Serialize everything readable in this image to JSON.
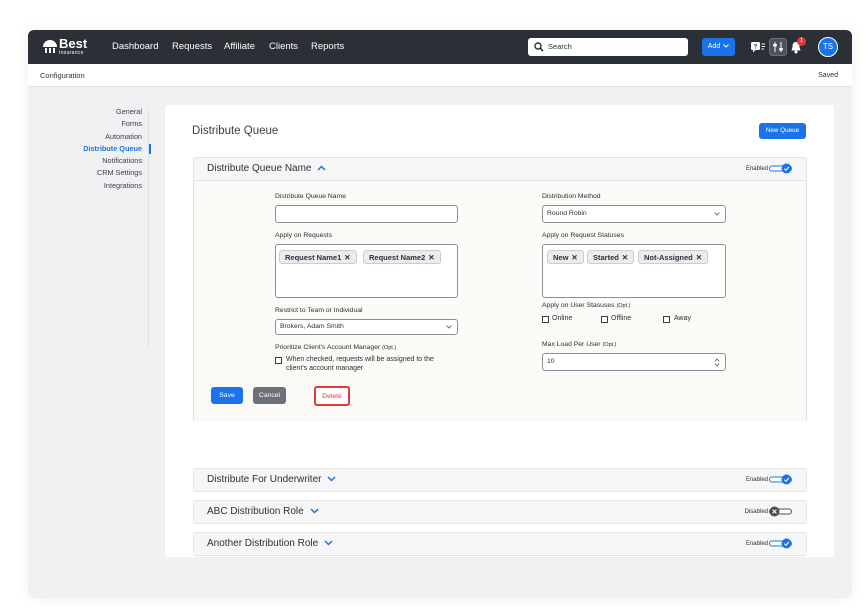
{
  "brand": {
    "name": "Best",
    "tagline": "Insurance"
  },
  "nav": {
    "items": [
      "Dashboard",
      "Requests",
      "Affiliate",
      "Clients",
      "Reports"
    ]
  },
  "search": {
    "placeholder": "Search"
  },
  "toolbar": {
    "add_label": "Add",
    "notification_count": "1",
    "avatar_initials": "TS"
  },
  "breadcrumb": {
    "label": "Configuration",
    "status": "Saved"
  },
  "sidebar": {
    "items": [
      {
        "label": "General",
        "active": false
      },
      {
        "label": "Forms",
        "active": false
      },
      {
        "label": "Automation",
        "active": false
      },
      {
        "label": "Distribute Queue",
        "active": true
      },
      {
        "label": "Notifications",
        "active": false
      },
      {
        "label": "CRM Settings",
        "active": false
      },
      {
        "label": "Integrations",
        "active": false
      }
    ]
  },
  "page": {
    "title": "Distribute Queue",
    "new_button": "New Queue"
  },
  "queues": [
    {
      "title": "Distribute Queue Name",
      "expanded": true,
      "state_label": "Enabled",
      "enabled": true
    },
    {
      "title": "Distribute For Underwriter",
      "expanded": false,
      "state_label": "Enabled",
      "enabled": true
    },
    {
      "title": "ABC Distribution Role",
      "expanded": false,
      "state_label": "Disabled",
      "enabled": false
    },
    {
      "title": "Another Distribution Role",
      "expanded": false,
      "state_label": "Enabled",
      "enabled": true
    }
  ],
  "form": {
    "name_label": "Distribute Queue Name",
    "name_value": "",
    "method_label": "Distribution Method",
    "method_value": "Round Robin",
    "requests_label": "Apply on Requests",
    "requests": [
      "Request Name1",
      "Request Name2"
    ],
    "statuses_label": "Apply on Request Statuses",
    "statuses": [
      "New",
      "Started",
      "Not-Assigned"
    ],
    "restrict_label": "Restrict to Team or Individual",
    "restrict_value": "Brokers, Adam Smith",
    "user_status_label": "Apply on User Stasuses",
    "user_status_opt": "(Opt.)",
    "user_statuses": [
      {
        "label": "Online",
        "checked": false
      },
      {
        "label": "Offline",
        "checked": false
      },
      {
        "label": "Away",
        "checked": false
      }
    ],
    "prioritize_label": "Prioritize Client's Account Manager",
    "prioritize_opt": "(Opt.)",
    "prioritize_line1": "When checked, requests will be assigned to the",
    "prioritize_line2": "client's account manager",
    "maxload_label": "Max Load Per User",
    "maxload_opt": "(Opt.)",
    "maxload_value": "10",
    "save_label": "Save",
    "cancel_label": "Cancel",
    "delete_label": "Delete"
  },
  "colors": {
    "accent": "#1a73e8",
    "topbar": "#2b2f36",
    "danger": "#e53935",
    "toggle_off": "#4a4f57"
  }
}
